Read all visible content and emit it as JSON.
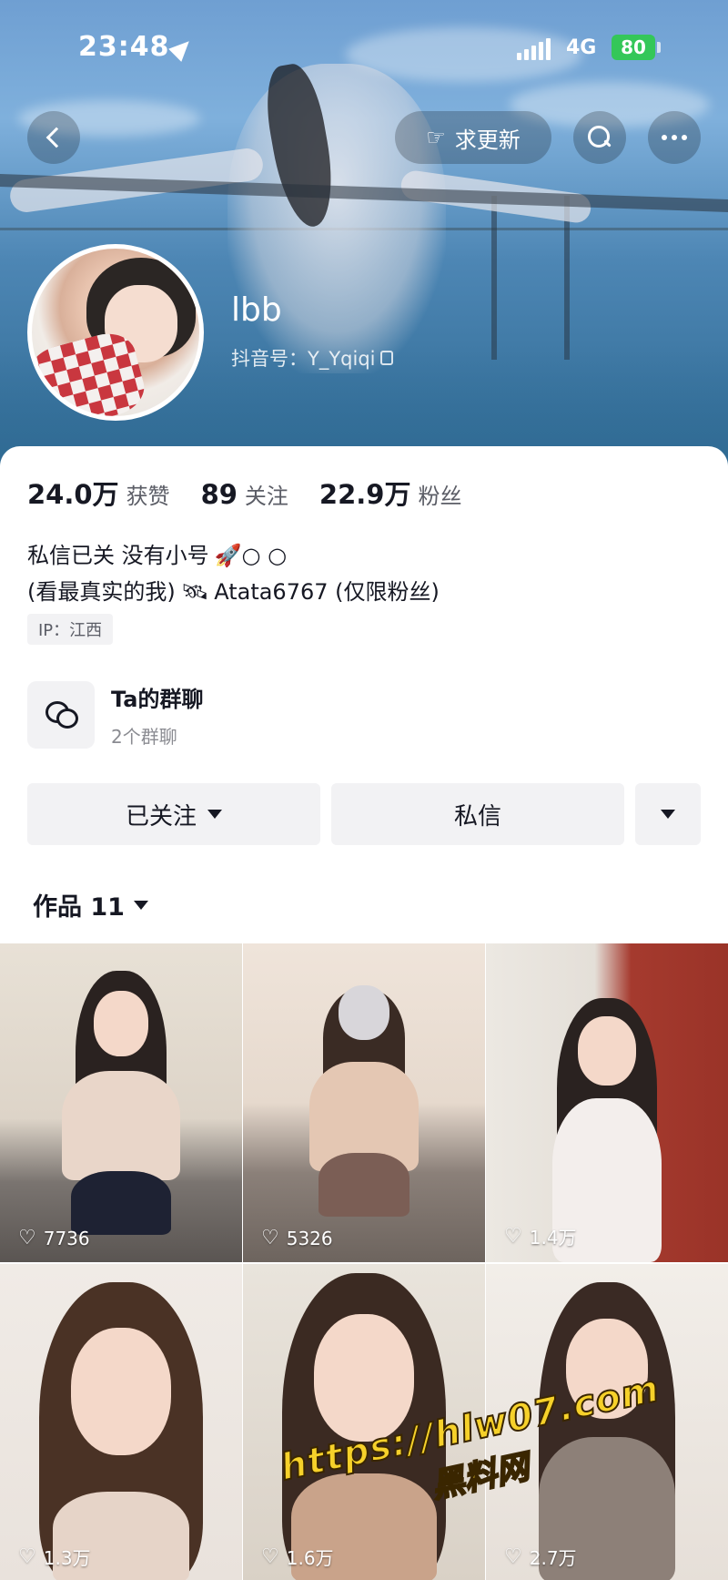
{
  "status": {
    "time": "23:48",
    "network": "4G",
    "battery": "80"
  },
  "nav": {
    "back_icon": "back-chevron-icon",
    "update_label": "求更新",
    "update_icon": "pointing-hand-icon",
    "search_icon": "search-icon",
    "more_icon": "more-dots-icon"
  },
  "profile": {
    "name": "lbb",
    "douyin_id": "抖音号：Y_Yqiqi"
  },
  "stats": [
    {
      "value": "24.0万",
      "label": "获赞"
    },
    {
      "value": "89",
      "label": "关注"
    },
    {
      "value": "22.9万",
      "label": "粉丝"
    }
  ],
  "bio": {
    "line1": "私信已关  没有小号",
    "line1_emoji": "🚀○ ○",
    "line2_prefix": "(看最真实的我)",
    "line2_emoji": "🛰",
    "line2_suffix": "Atata6767 (仅限粉丝)",
    "ip": "IP：江西"
  },
  "group_chat": {
    "title": "Ta的群聊",
    "subtitle": "2个群聊"
  },
  "actions": {
    "followed_label": "已关注",
    "message_label": "私信"
  },
  "works": {
    "label": "作品 11"
  },
  "videos": [
    {
      "likes": "7736"
    },
    {
      "likes": "5326"
    },
    {
      "likes": "1.4万"
    },
    {
      "likes": "1.3万"
    },
    {
      "likes": "1.6万"
    },
    {
      "likes": "2.7万"
    }
  ],
  "watermark": {
    "url": "https://hlw07.com",
    "name": "黑料网"
  },
  "colors": {
    "accent_text": "#161823",
    "button_bg": "#f2f2f4",
    "battery_green": "#34c759",
    "watermark_yellow": "#f6d12a"
  }
}
